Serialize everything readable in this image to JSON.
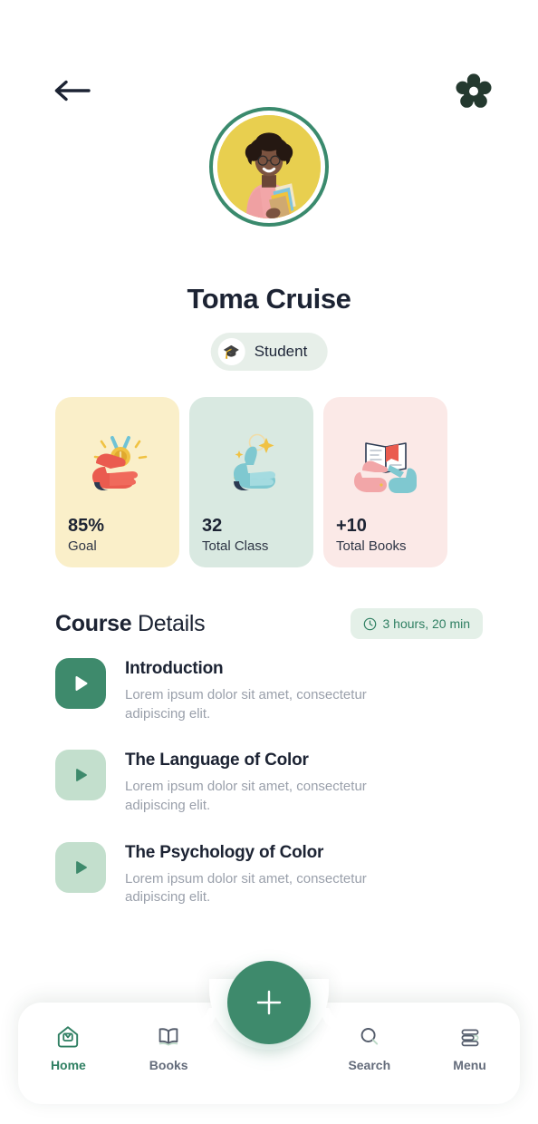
{
  "theme": {
    "green": "#3e8a6c",
    "dark_green": "#24392f",
    "text_dark": "#1c2333",
    "text_muted": "#9aa0ab",
    "nav_inactive": "#646c7b"
  },
  "topbar": {
    "back_icon": "arrow-left-icon",
    "settings_icon": "gear-icon"
  },
  "profile": {
    "avatar_alt": "student-avatar",
    "name": "Toma Cruise",
    "role_emoji": "🎓",
    "role_label": "Student"
  },
  "stats": [
    {
      "value": "85%",
      "label": "Goal",
      "icon": "medal-hand-icon",
      "bg": "#faefc9"
    },
    {
      "value": "32",
      "label": "Total Class",
      "icon": "thumbs-up-icon",
      "bg": "#d9e9e1"
    },
    {
      "value": "+10",
      "label": "Total Books",
      "icon": "open-book-hands-icon",
      "bg": "#fbe9e7"
    }
  ],
  "course": {
    "title_bold": "Course",
    "title_light": " Details",
    "duration_icon": "clock-icon",
    "duration": "3 hours, 20 min"
  },
  "lessons": [
    {
      "title": "Introduction",
      "description": "Lorem ipsum dolor sit amet, consectetur adipiscing elit.",
      "state": "active"
    },
    {
      "title": "The Language of Color",
      "description": "Lorem ipsum dolor sit amet, consectetur adipiscing elit.",
      "state": "idle"
    },
    {
      "title": "The Psychology of Color",
      "description": "Lorem ipsum dolor sit amet, consectetur adipiscing elit.",
      "state": "idle"
    }
  ],
  "fab": {
    "icon": "plus-icon",
    "label": "+"
  },
  "nav": {
    "items": [
      {
        "label": "Home",
        "icon": "home-icon",
        "active": true
      },
      {
        "label": "Books",
        "icon": "book-icon",
        "active": false
      },
      {
        "label": "Search",
        "icon": "search-icon",
        "active": false
      },
      {
        "label": "Menu",
        "icon": "menu-icon",
        "active": false
      }
    ]
  }
}
